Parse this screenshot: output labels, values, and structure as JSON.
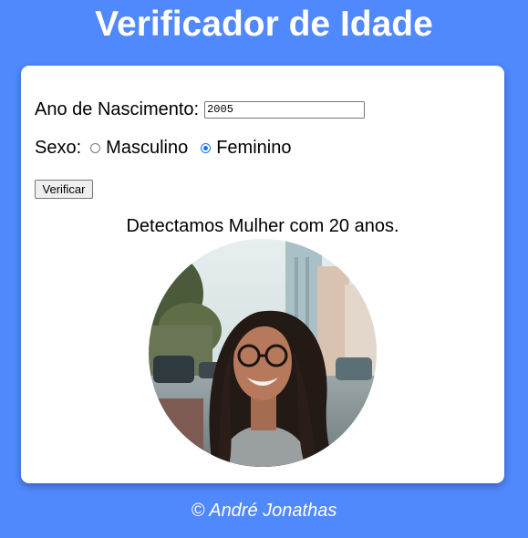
{
  "header": {
    "title": "Verificador de Idade"
  },
  "form": {
    "ano_label": "Ano de Nascimento:",
    "ano_value": "2005",
    "sexo_label": "Sexo:",
    "options": [
      {
        "label": "Masculino",
        "checked": false
      },
      {
        "label": "Feminino",
        "checked": true
      }
    ],
    "button_label": "Verificar"
  },
  "result": {
    "text": "Detectamos Mulher com 20 anos."
  },
  "footer": {
    "text": "© André Jonathas"
  },
  "colors": {
    "background": "#5088fd",
    "card": "#ffffff",
    "radio_selected": "#1a73e8"
  }
}
